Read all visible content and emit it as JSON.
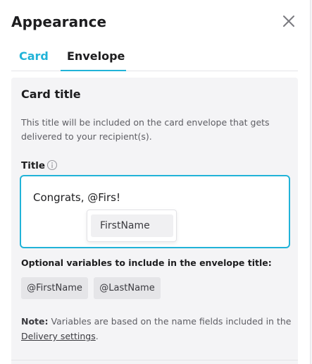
{
  "header": {
    "title": "Appearance",
    "close_icon": "close-icon"
  },
  "tabs": [
    {
      "label": "Card",
      "active": false
    },
    {
      "label": "Envelope",
      "active": true
    }
  ],
  "section": {
    "title": "Card title",
    "description": "This title will be included on the card envelope that gets delivered to your recipient(s).",
    "field_label": "Title",
    "info_icon": "info-icon",
    "input_value": "Congrats, @Firs!",
    "suggestion": "FirstName",
    "variables_label": "Optional variables to include in the envelope title:",
    "variables": [
      "@FirstName",
      "@LastName"
    ],
    "note_bold": "Note:",
    "note_text": " Variables are based on the name fields included in the ",
    "note_link": "Delivery settings",
    "note_end": "."
  },
  "colors": {
    "accent": "#21b3d8",
    "section_bg": "#f4f4f6",
    "chip_bg": "#e5e5e8"
  }
}
